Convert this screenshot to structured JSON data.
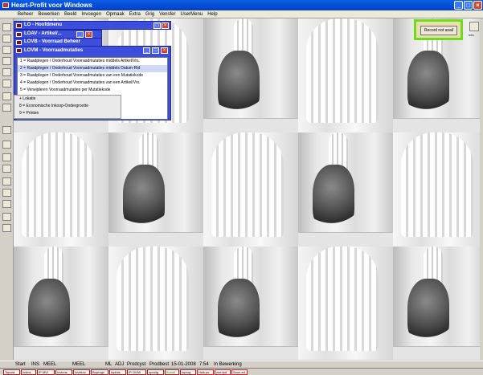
{
  "window": {
    "title": "Heart-Profit voor Windows",
    "minimize": "_",
    "maximize": "□",
    "close": "×"
  },
  "menu": [
    "Beheer",
    "Bewerken",
    "Beeld",
    "Invoegen",
    "Opmaak",
    "Extra",
    "Grig",
    "Vensfer",
    "UserMenu",
    "Help"
  ],
  "mdi_windows": [
    {
      "title": "LO - Hoofdmenu"
    },
    {
      "title": "LOAV - Artikel/..."
    },
    {
      "title": "LOVB - Voorraad Beheer"
    }
  ],
  "active_window": {
    "title": "LOVM - Voorraadmutaties",
    "items": [
      "1 = Raadplegen / Onderhoud Voorraadmutaties middels Artikel/Vrs.",
      "2 = Raadplegen / Onderhoud Voorraadmutaties middels Datum-Rtd",
      "3 = Raadplegen / Onderhoud Voorraadmutaties van een Mutatiekode",
      "4 = Raadplegen / Onderhoud Voorraadmutaties van een Artikel/Vrs.",
      "5 = Verwijderen Voorraadmutaties per Mutatiekode"
    ],
    "selected_index": 1
  },
  "background_menu": [
    "+ Lokatie",
    "8 = Economische Inkoop-Ondergrootte",
    "9 = Printen"
  ],
  "popup": {
    "button_label": "Record not avail"
  },
  "right_panel": {
    "label": "Info"
  },
  "status": {
    "start": "Start",
    "ins": "INS",
    "meel1": "MEEL",
    "meel2": "MEEL",
    "ml": "ML",
    "adj": "ADJ",
    "product": "Prodcyst",
    "prodbest": "Prodbest",
    "date": "15-01-2008",
    "time": "7:54",
    "mode": "In Bewerking"
  },
  "taskbar": [
    "Topora",
    "Iovins",
    "IP MVI",
    "Iovinns",
    "Iovekov",
    "Boprugv",
    "Iopinis",
    "IP OVMI",
    "opruilg",
    "Buriall",
    "Ioprog",
    "Hulk.ps",
    "zoe.fpd",
    "Soon.ed"
  ],
  "colors": {
    "title_blue": "#0a5fe6",
    "mdi_blue": "#3c4edb",
    "popup_border": "#6fdc1a",
    "task_border": "#a02020"
  }
}
